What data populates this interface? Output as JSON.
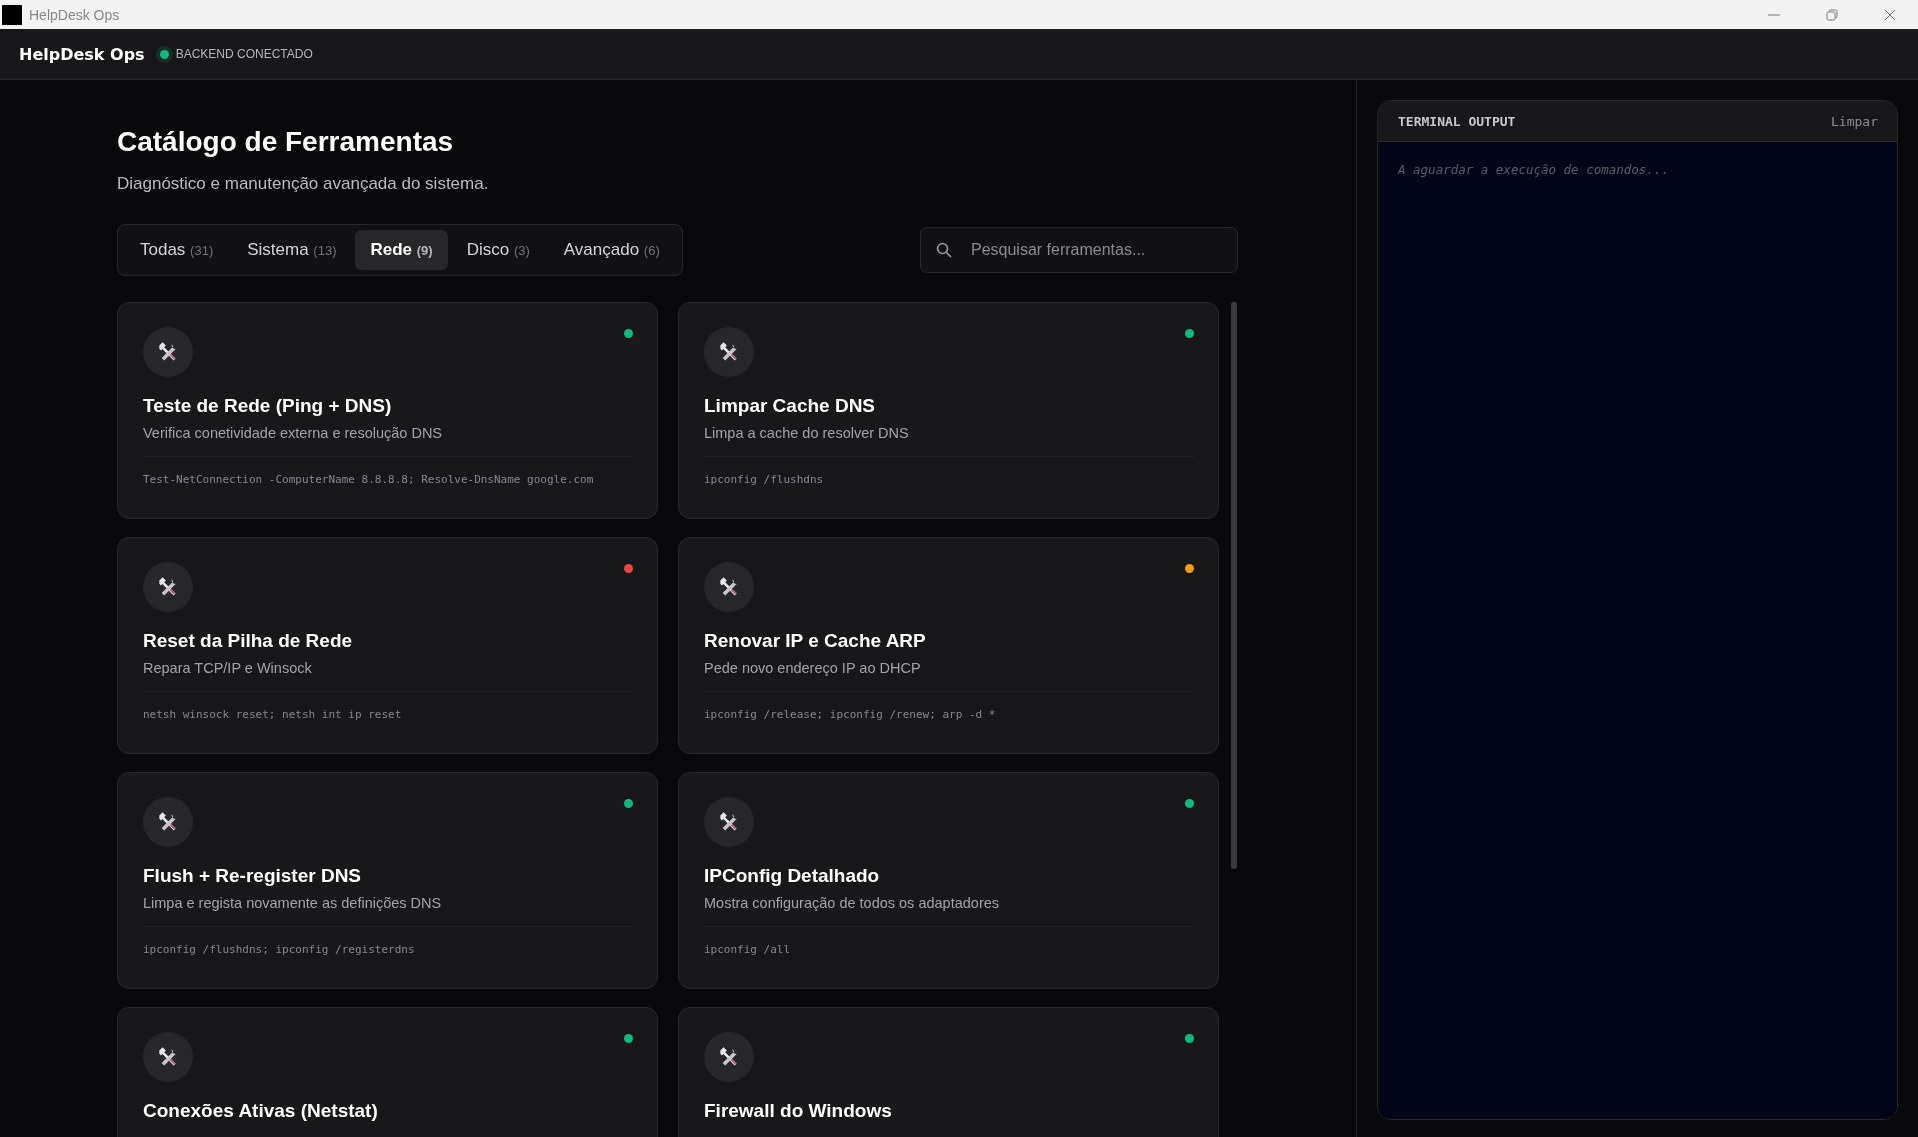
{
  "window": {
    "title": "HelpDesk Ops"
  },
  "header": {
    "brand": "HelpDesk Ops",
    "status": {
      "label": "BACKEND CONECTADO",
      "connected": true
    }
  },
  "page": {
    "title": "Catálogo de Ferramentas",
    "subtitle": "Diagnóstico e manutenção avançada do sistema."
  },
  "tabs": [
    {
      "label": "Todas",
      "count": "(31)",
      "selected": false
    },
    {
      "label": "Sistema",
      "count": "(13)",
      "selected": false
    },
    {
      "label": "Rede",
      "count": "(9)",
      "selected": true
    },
    {
      "label": "Disco",
      "count": "(3)",
      "selected": false
    },
    {
      "label": "Avançado",
      "count": "(6)",
      "selected": false
    }
  ],
  "search": {
    "placeholder": "Pesquisar ferramentas..."
  },
  "tools": [
    {
      "title": "Teste de Rede (Ping + DNS)",
      "description": "Verifica conetividade externa e resolução DNS",
      "command": "Test-NetConnection -ComputerName 8.8.8.8; Resolve-DnsName google.com",
      "color": "#10b981"
    },
    {
      "title": "Limpar Cache DNS",
      "description": "Limpa a cache do resolver DNS",
      "command": "ipconfig /flushdns",
      "color": "#10b981"
    },
    {
      "title": "Reset da Pilha de Rede",
      "description": "Repara TCP/IP e Winsock",
      "command": "netsh winsock reset; netsh int ip reset",
      "color": "#ef4444"
    },
    {
      "title": "Renovar IP e Cache ARP",
      "description": "Pede novo endereço IP ao DHCP",
      "command": "ipconfig /release; ipconfig /renew; arp -d *",
      "color": "#f59e0b"
    },
    {
      "title": "Flush + Re-register DNS",
      "description": "Limpa e regista novamente as definições DNS",
      "command": "ipconfig /flushdns; ipconfig /registerdns",
      "color": "#10b981"
    },
    {
      "title": "IPConfig Detalhado",
      "description": "Mostra configuração de todos os adaptadores",
      "command": "ipconfig /all",
      "color": "#10b981"
    },
    {
      "title": "Conexões Ativas (Netstat)",
      "color": "#10b981"
    },
    {
      "title": "Firewall do Windows",
      "color": "#10b981"
    }
  ],
  "terminal": {
    "title": "TERMINAL OUTPUT",
    "clear_button": "Limpar",
    "placeholder": "A aguardar a execução de comandos..."
  }
}
